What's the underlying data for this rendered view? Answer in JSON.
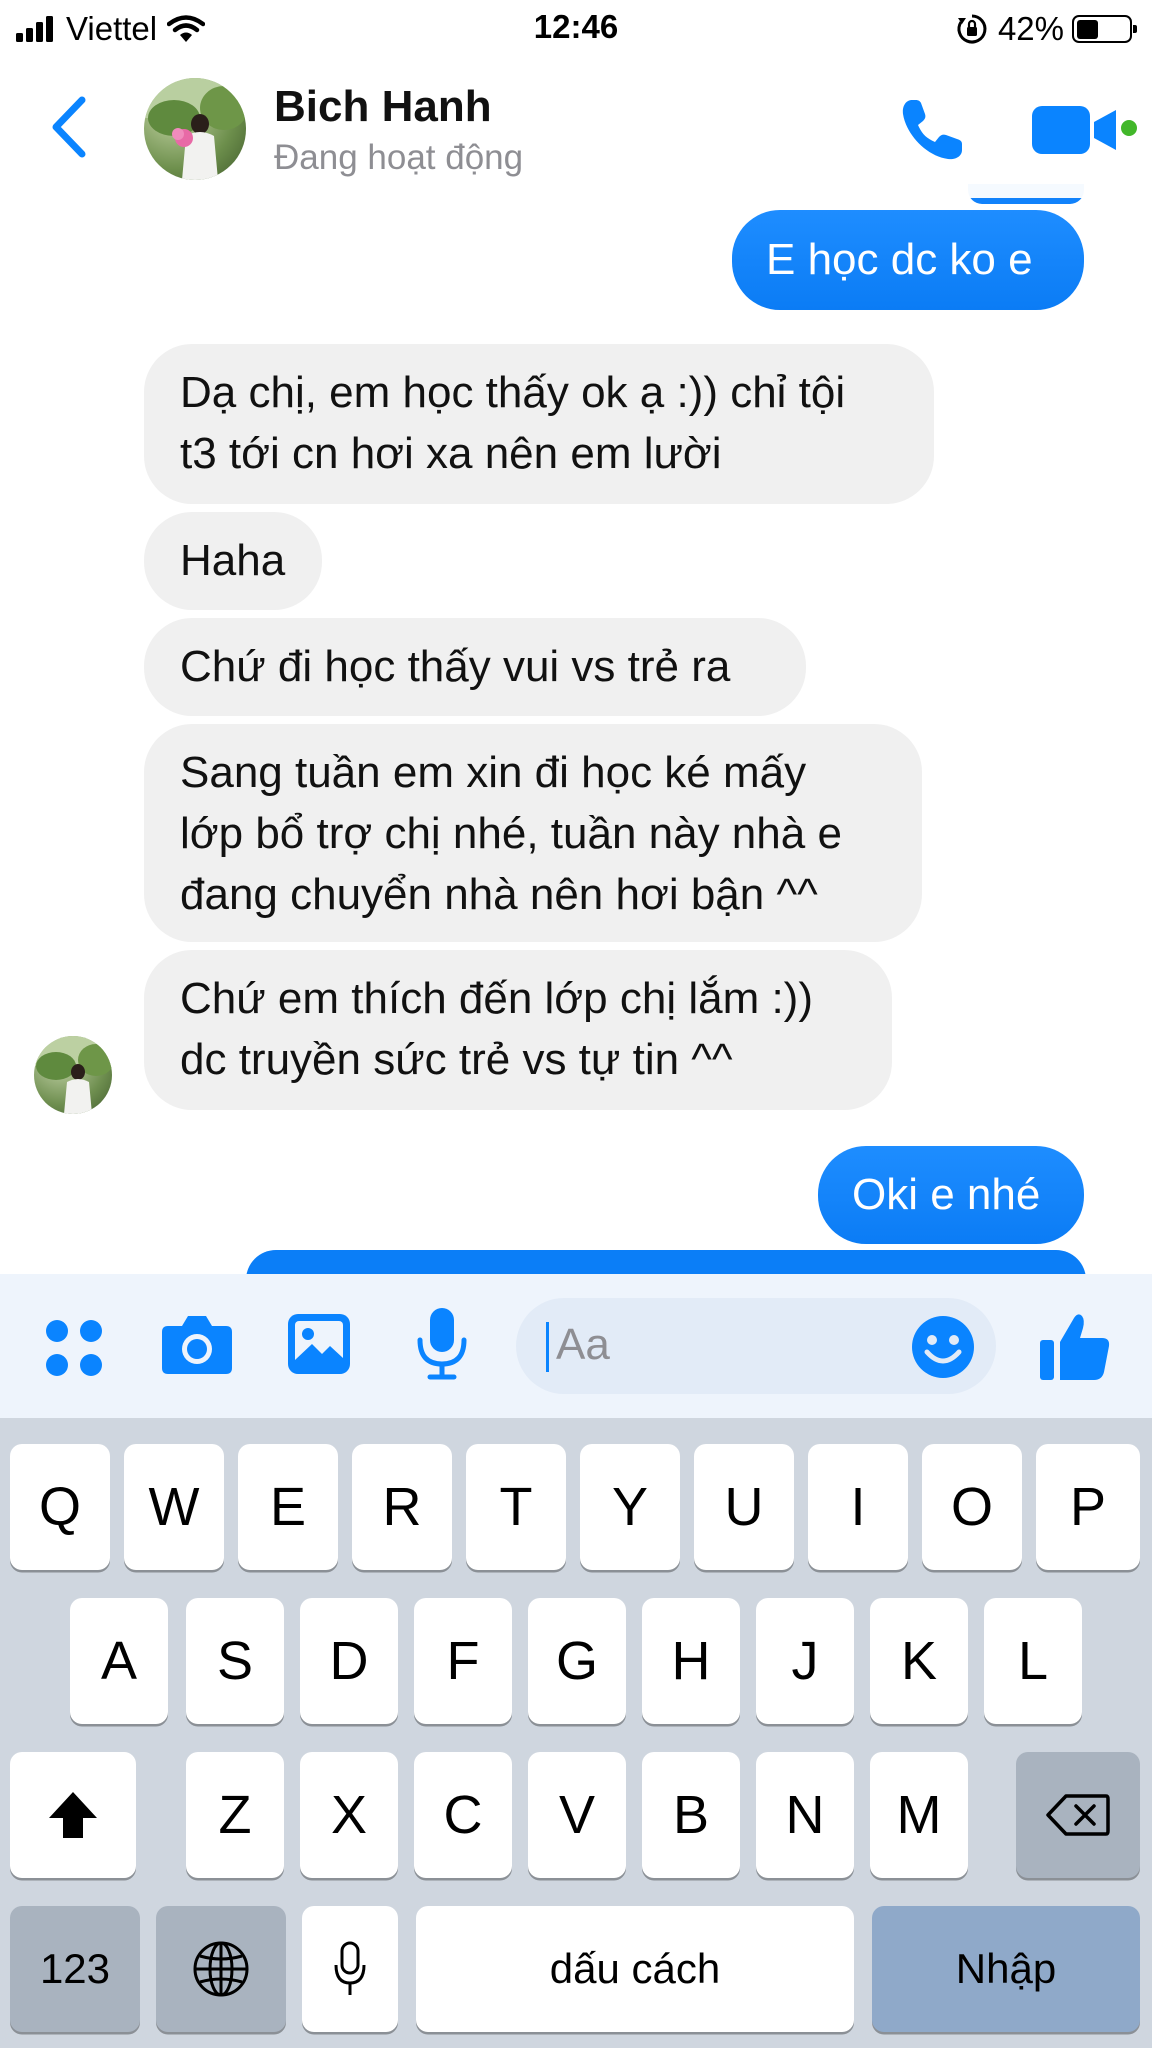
{
  "status_bar": {
    "carrier": "Viettel",
    "time": "12:46",
    "battery_percent": "42%",
    "battery_level": 0.42
  },
  "header": {
    "contact_name": "Bich Hanh",
    "contact_status": "Đang hoạt động",
    "icons": [
      "back-icon",
      "phone-icon",
      "video-call-icon"
    ],
    "active_color": "#42b72a"
  },
  "messages": [
    {
      "side": "out",
      "lines": [
        "E học dc ko e"
      ]
    },
    {
      "side": "in",
      "lines": [
        "Dạ chị, em học thấy ok ạ :)) chỉ tội",
        "t3 tới cn hơi xa nên em lười"
      ]
    },
    {
      "side": "in",
      "lines": [
        "Haha"
      ]
    },
    {
      "side": "in",
      "lines": [
        "Chứ đi học thấy vui vs trẻ ra"
      ]
    },
    {
      "side": "in",
      "lines": [
        "Sang tuần em xin đi học ké mấy",
        "lớp bổ trợ chị nhé, tuần này nhà e",
        "đang chuyển nhà nên hơi bận ^^"
      ]
    },
    {
      "side": "in",
      "lines": [
        "Chứ em thích đến lớp chị lắm :))",
        "dc truyền sức trẻ vs tự tin ^^"
      ]
    },
    {
      "side": "out",
      "lines": [
        "Oki e nhé"
      ]
    }
  ],
  "composer": {
    "placeholder": "Aa",
    "icons": [
      "apps-icon",
      "camera-icon",
      "gallery-icon",
      "microphone-icon",
      "emoji-icon",
      "like-icon"
    ]
  },
  "keyboard": {
    "row1": [
      "Q",
      "W",
      "E",
      "R",
      "T",
      "Y",
      "U",
      "I",
      "O",
      "P"
    ],
    "row2": [
      "A",
      "S",
      "D",
      "F",
      "G",
      "H",
      "J",
      "K",
      "L"
    ],
    "row3": [
      "Z",
      "X",
      "C",
      "V",
      "B",
      "N",
      "M"
    ],
    "numbers_key": "123",
    "space_label": "dấu cách",
    "enter_label": "Nhập"
  },
  "colors": {
    "accent": "#0a84ff",
    "incoming_bubble": "#f0f0f0",
    "keyboard_bg": "#cfd6df"
  }
}
